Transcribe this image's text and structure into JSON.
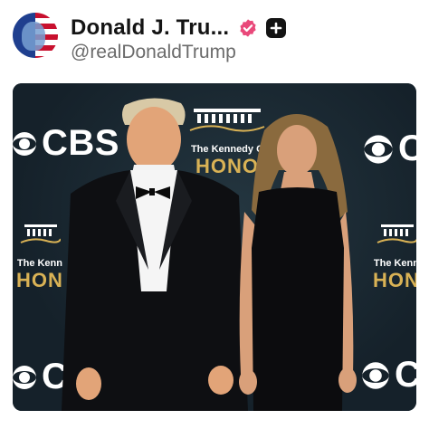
{
  "post": {
    "display_name": "Donald J. Tru...",
    "handle": "@realDonaldTrump",
    "verified_icon": "verified-badge-icon",
    "plus_icon": "plus-badge-icon",
    "colors": {
      "verified": "#e9497a",
      "name": "#141414",
      "handle": "#6b6b6b"
    }
  },
  "photo": {
    "backdrop_logos": [
      "CBS",
      "CBS",
      "CBS",
      "CBS"
    ],
    "backdrop_captions": [
      "The Kennedy C",
      "The Kenn",
      "The Kenn"
    ],
    "backdrop_honors": [
      "HONO",
      "HON",
      "HON"
    ]
  }
}
